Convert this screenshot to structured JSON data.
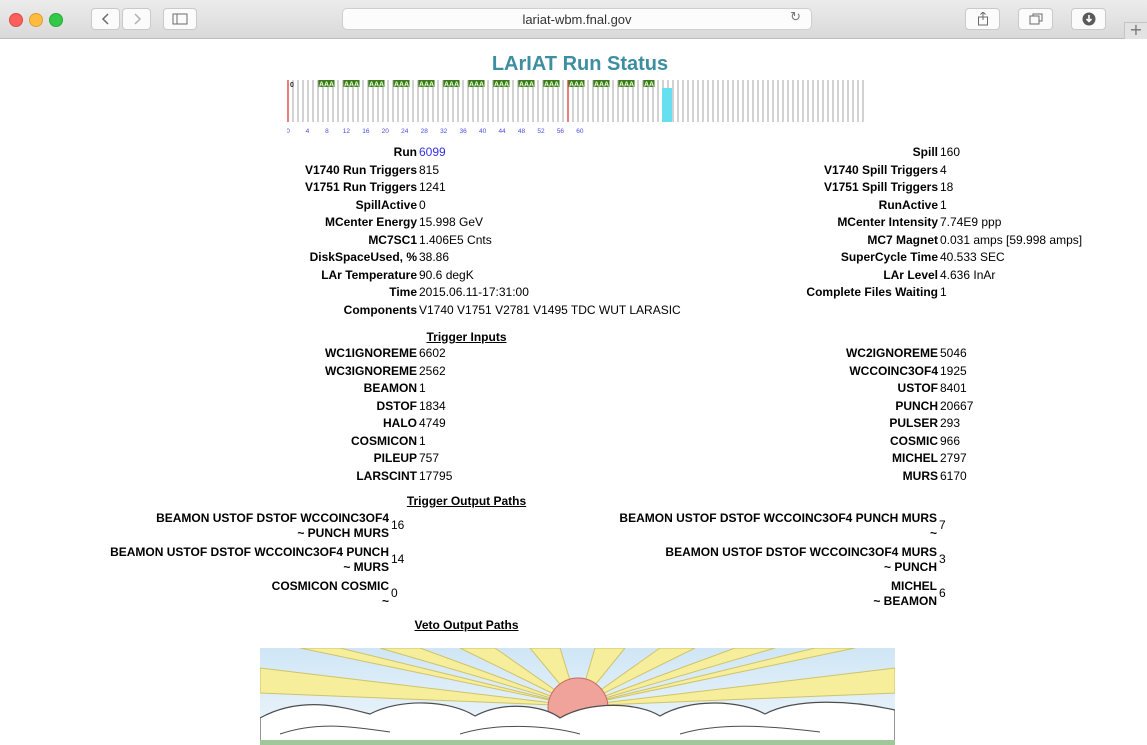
{
  "browser": {
    "url": "lariat-wbm.fnal.gov",
    "icons": {
      "back": "chevron-left-icon",
      "forward": "chevron-right-icon",
      "sidebar": "sidebar-icon",
      "reload": "reload-icon",
      "share": "share-icon",
      "tabs": "tabs-icon",
      "downloads": "download-icon",
      "new_tab": "plus-icon"
    }
  },
  "page": {
    "title": "LArIAT Run Status",
    "spill_bar": {
      "tick_labels": [
        "0",
        "4",
        "8",
        "12",
        "16",
        "20",
        "24",
        "28",
        "32",
        "36",
        "40",
        "44",
        "48",
        "52",
        "56",
        "60"
      ],
      "marker_label": "0",
      "a_label": "A",
      "a_slots": [
        6,
        7,
        8,
        11,
        12,
        13,
        16,
        17,
        18,
        21,
        22,
        23,
        26,
        27,
        28,
        31,
        32,
        33,
        36,
        37,
        38,
        41,
        42,
        43,
        46,
        47,
        48,
        51,
        52,
        53,
        56,
        57,
        58,
        61,
        62,
        63,
        66,
        67,
        68,
        71,
        72
      ],
      "red_slots": [
        0,
        56
      ],
      "current_slot": 76,
      "total_slots": 116,
      "colors": {
        "a_bg": "#3a7a1a",
        "a_text": "#e9ffd6",
        "red": "#e85050",
        "current": "#66e0f0",
        "slot_line": "#a6a6a6",
        "tick_label": "#4a4ae0"
      }
    },
    "left_fields": [
      {
        "label": "Run",
        "value": "6099"
      },
      {
        "label": "V1740 Run Triggers",
        "value": "815"
      },
      {
        "label": "V1751 Run Triggers",
        "value": "1241"
      },
      {
        "label": "SpillActive",
        "value": "0"
      },
      {
        "label": "MCenter Energy",
        "value": "15.998 GeV"
      },
      {
        "label": "MC7SC1",
        "value": "1.406E5 Cnts"
      },
      {
        "label": "DiskSpaceUsed, %",
        "value": "38.86"
      },
      {
        "label": "LAr Temperature",
        "value": "90.6 degK"
      },
      {
        "label": "Time",
        "value": "2015.06.11-17:31:00"
      },
      {
        "label": "Components",
        "value": "V1740 V1751 V2781 V1495 TDC WUT LARASIC"
      }
    ],
    "right_fields": [
      {
        "label": "Spill",
        "value": "160"
      },
      {
        "label": "V1740 Spill Triggers",
        "value": "4"
      },
      {
        "label": "V1751 Spill Triggers",
        "value": "18"
      },
      {
        "label": "RunActive",
        "value": "1"
      },
      {
        "label": "MCenter Intensity",
        "value": "7.74E9 ppp"
      },
      {
        "label": "MC7 Magnet",
        "value": "0.031 amps [59.998 amps]"
      },
      {
        "label": "SuperCycle Time",
        "value": "40.533 SEC"
      },
      {
        "label": "LAr Level",
        "value": "4.636 InAr"
      },
      {
        "label": "Complete Files Waiting",
        "value": "1"
      }
    ],
    "trigger_inputs_heading": "Trigger Inputs",
    "trigger_inputs_left": [
      {
        "label": "WC1IGNOREME",
        "value": "6602"
      },
      {
        "label": "WC3IGNOREME",
        "value": "2562"
      },
      {
        "label": "BEAMON",
        "value": "1"
      },
      {
        "label": "DSTOF",
        "value": "1834"
      },
      {
        "label": "HALO",
        "value": "4749"
      },
      {
        "label": "COSMICON",
        "value": "1"
      },
      {
        "label": "PILEUP",
        "value": "757"
      },
      {
        "label": "LARSCINT",
        "value": "17795"
      }
    ],
    "trigger_inputs_right": [
      {
        "label": "WC2IGNOREME",
        "value": "5046"
      },
      {
        "label": "WCCOINC3OF4",
        "value": "1925"
      },
      {
        "label": "USTOF",
        "value": "8401"
      },
      {
        "label": "PUNCH",
        "value": "20667"
      },
      {
        "label": "PULSER",
        "value": "293"
      },
      {
        "label": "COSMIC",
        "value": "966"
      },
      {
        "label": "MICHEL",
        "value": "2797"
      },
      {
        "label": "MURS",
        "value": "6170"
      }
    ],
    "trigger_output_heading": "Trigger Output Paths",
    "trigger_output_left": [
      {
        "line1": "BEAMON USTOF DSTOF WCCOINC3OF4",
        "line2": "~ PUNCH MURS",
        "value": "16"
      },
      {
        "line1": "BEAMON USTOF DSTOF WCCOINC3OF4 PUNCH",
        "line2": "~ MURS",
        "value": "14"
      },
      {
        "line1": "COSMICON COSMIC",
        "line2": "~",
        "value": "0"
      }
    ],
    "trigger_output_right": [
      {
        "line1": "BEAMON USTOF DSTOF WCCOINC3OF4 PUNCH MURS",
        "line2": "~",
        "value": "7"
      },
      {
        "line1": "BEAMON USTOF DSTOF WCCOINC3OF4 MURS",
        "line2": "~ PUNCH",
        "value": "3"
      },
      {
        "line1": "MICHEL",
        "line2": "~ BEAMON",
        "value": "6"
      }
    ],
    "veto_output_heading": "Veto Output Paths"
  }
}
